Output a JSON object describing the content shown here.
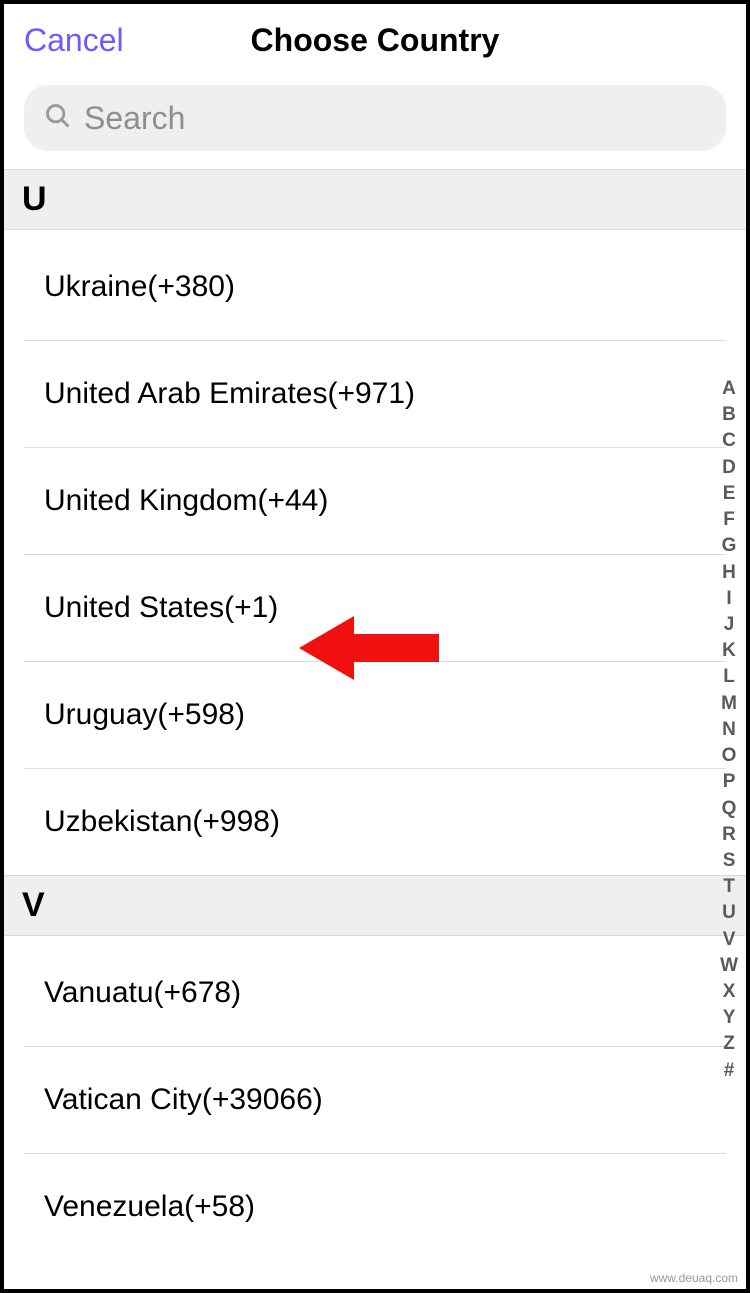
{
  "header": {
    "cancel": "Cancel",
    "title": "Choose Country"
  },
  "search": {
    "placeholder": "Search"
  },
  "sections": [
    {
      "letter": "U",
      "items": [
        {
          "label": "Ukraine(+380)"
        },
        {
          "label": "United Arab Emirates(+971)"
        },
        {
          "label": "United Kingdom(+44)"
        },
        {
          "label": "United States(+1)"
        },
        {
          "label": "Uruguay(+598)"
        },
        {
          "label": "Uzbekistan(+998)"
        }
      ]
    },
    {
      "letter": "V",
      "items": [
        {
          "label": "Vanuatu(+678)"
        },
        {
          "label": "Vatican City(+39066)"
        },
        {
          "label": "Venezuela(+58)"
        }
      ]
    }
  ],
  "alpha_index": [
    "A",
    "B",
    "C",
    "D",
    "E",
    "F",
    "G",
    "H",
    "I",
    "J",
    "K",
    "L",
    "M",
    "N",
    "O",
    "P",
    "Q",
    "R",
    "S",
    "T",
    "U",
    "V",
    "W",
    "X",
    "Y",
    "Z",
    "#"
  ],
  "watermark": "www.deuaq.com"
}
